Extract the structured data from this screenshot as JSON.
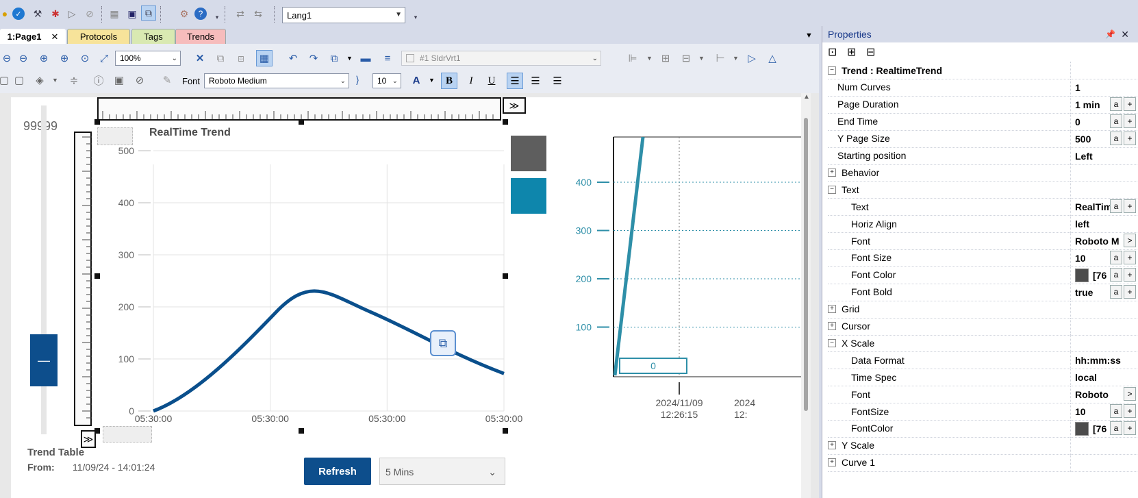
{
  "toolbar": {
    "language": "Lang1"
  },
  "tabs": [
    {
      "label": "1:Page1"
    },
    {
      "label": "Protocols"
    },
    {
      "label": "Tags"
    },
    {
      "label": "Trends"
    }
  ],
  "editor": {
    "zoom": "100%",
    "object_select": "#1 SldrVrt1",
    "font_label": "Font",
    "font_name": "Roboto Medium",
    "font_size": "10"
  },
  "page": {
    "slider_value": "99999",
    "trend_title": "RealTime Trend",
    "y_ticks": [
      "500",
      "400",
      "300",
      "200",
      "100",
      "0"
    ],
    "x_ticks": [
      "05:30:00",
      "05:30:00",
      "05:30:00",
      "05:30:00"
    ],
    "trend_table_title": "Trend Table",
    "from_label": "From:",
    "from_value": "11/09/24 - 14:01:24",
    "refresh_label": "Refresh",
    "range_value": "5 Mins",
    "right_trend": {
      "y_ticks": [
        "400",
        "300",
        "200",
        "100"
      ],
      "cursor_value": "0",
      "x_date": "2024/11/09",
      "x_time": "12:26:15",
      "x_date2": "2024",
      "x_time2": "12:"
    },
    "colors": {
      "curve": "#0a4f8c",
      "pen1": "#5e5e5e",
      "pen2": "#0e86ac",
      "right_axis": "#2e8fa8"
    }
  },
  "properties": {
    "title": "Properties",
    "rows": [
      {
        "kind": "group",
        "name": "Trend : RealtimeTrend",
        "state": "minus",
        "level": 0
      },
      {
        "kind": "prop",
        "name": "Num Curves",
        "value": "1",
        "level": 1,
        "buttons": ""
      },
      {
        "kind": "prop",
        "name": "Page Duration",
        "value": "1 min",
        "level": 1,
        "buttons": "a+"
      },
      {
        "kind": "prop",
        "name": "End Time",
        "value": "0",
        "level": 1,
        "buttons": "a+"
      },
      {
        "kind": "prop",
        "name": "Y Page Size",
        "value": "500",
        "level": 1,
        "buttons": "a+"
      },
      {
        "kind": "prop",
        "name": "Starting position",
        "value": "Left",
        "level": 1,
        "buttons": ""
      },
      {
        "kind": "group",
        "name": "Behavior",
        "state": "plus",
        "level": 0
      },
      {
        "kind": "group",
        "name": "Text",
        "state": "minus",
        "level": 0
      },
      {
        "kind": "prop",
        "name": "Text",
        "value": "RealTim",
        "level": 2,
        "buttons": "a+"
      },
      {
        "kind": "prop",
        "name": "Horiz Align",
        "value": "left",
        "level": 2,
        "buttons": ""
      },
      {
        "kind": "prop",
        "name": "Font",
        "value": "Roboto M",
        "level": 2,
        "buttons": ">"
      },
      {
        "kind": "prop",
        "name": "Font Size",
        "value": "10",
        "level": 2,
        "buttons": "a+"
      },
      {
        "kind": "prop",
        "name": "Font Color",
        "value": "[76",
        "level": 2,
        "buttons": "a+",
        "swatch": true
      },
      {
        "kind": "prop",
        "name": "Font Bold",
        "value": "true",
        "level": 2,
        "buttons": "a+"
      },
      {
        "kind": "group",
        "name": "Grid",
        "state": "plus",
        "level": 0
      },
      {
        "kind": "group",
        "name": "Cursor",
        "state": "plus",
        "level": 0
      },
      {
        "kind": "group",
        "name": "X Scale",
        "state": "minus",
        "level": 0
      },
      {
        "kind": "prop",
        "name": "Data Format",
        "value": "hh:mm:ss",
        "level": 2,
        "buttons": ""
      },
      {
        "kind": "prop",
        "name": "Time Spec",
        "value": "local",
        "level": 2,
        "buttons": ""
      },
      {
        "kind": "prop",
        "name": "Font",
        "value": "Roboto",
        "level": 2,
        "buttons": ">"
      },
      {
        "kind": "prop",
        "name": "FontSize",
        "value": "10",
        "level": 2,
        "buttons": "a+"
      },
      {
        "kind": "prop",
        "name": "FontColor",
        "value": "[76",
        "level": 2,
        "buttons": "a+",
        "swatch": true
      },
      {
        "kind": "group",
        "name": "Y Scale",
        "state": "plus",
        "level": 0
      },
      {
        "kind": "group",
        "name": "Curve 1",
        "state": "plus",
        "level": 0
      }
    ]
  }
}
